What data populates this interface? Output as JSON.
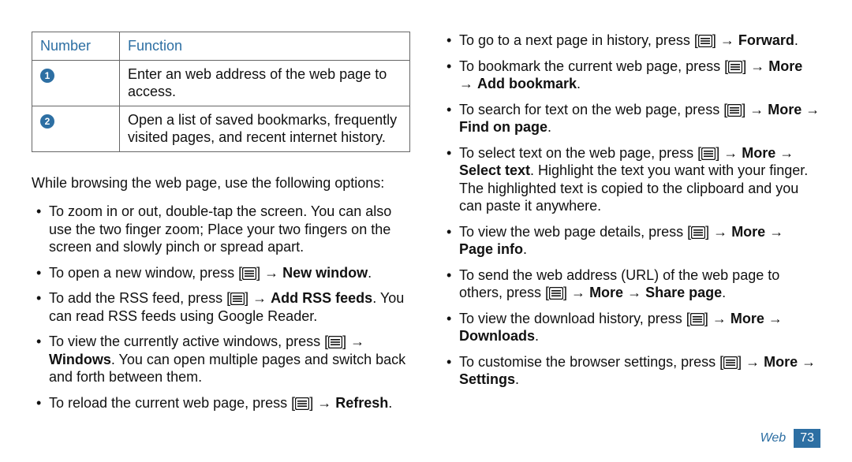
{
  "table": {
    "headers": {
      "number": "Number",
      "function": "Function"
    },
    "rows": [
      {
        "num": "1",
        "func": "Enter an web address of the web page to access."
      },
      {
        "num": "2",
        "func": "Open a list of saved bookmarks, frequently visited pages, and recent internet history."
      }
    ]
  },
  "lead": "While browsing the web page, use the following options:",
  "left_items": [
    {
      "segments": [
        {
          "t": "To zoom in or out, double-tap the screen. You can also use the two finger zoom; Place your two fingers on the screen and slowly pinch or spread apart."
        }
      ]
    },
    {
      "segments": [
        {
          "t": "To open a new window, press ["
        },
        {
          "icon": true
        },
        {
          "t": "] → "
        },
        {
          "t": "New window",
          "b": true
        },
        {
          "t": "."
        }
      ]
    },
    {
      "segments": [
        {
          "t": "To add the RSS feed, press ["
        },
        {
          "icon": true
        },
        {
          "t": "] → "
        },
        {
          "t": "Add RSS feeds",
          "b": true
        },
        {
          "t": ". You can read RSS feeds using Google Reader."
        }
      ]
    },
    {
      "segments": [
        {
          "t": "To view the currently active windows, press ["
        },
        {
          "icon": true
        },
        {
          "t": "] → "
        },
        {
          "t": "Windows",
          "b": true
        },
        {
          "t": ". You can open multiple pages and switch back and forth between them."
        }
      ]
    },
    {
      "segments": [
        {
          "t": "To reload the current web page, press ["
        },
        {
          "icon": true
        },
        {
          "t": "] → "
        },
        {
          "t": "Refresh",
          "b": true
        },
        {
          "t": "."
        }
      ]
    }
  ],
  "right_items": [
    {
      "segments": [
        {
          "t": "To go to a next page in history, press ["
        },
        {
          "icon": true
        },
        {
          "t": "] → "
        },
        {
          "t": "Forward",
          "b": true
        },
        {
          "t": "."
        }
      ]
    },
    {
      "segments": [
        {
          "t": "To bookmark the current web page, press ["
        },
        {
          "icon": true
        },
        {
          "t": "] → "
        },
        {
          "t": "More",
          "b": true
        },
        {
          "t": " → "
        },
        {
          "t": "Add bookmark",
          "b": true
        },
        {
          "t": "."
        }
      ]
    },
    {
      "segments": [
        {
          "t": "To search for text on the web page, press ["
        },
        {
          "icon": true
        },
        {
          "t": "] → "
        },
        {
          "t": "More",
          "b": true
        },
        {
          "t": " → "
        },
        {
          "t": "Find on page",
          "b": true
        },
        {
          "t": "."
        }
      ]
    },
    {
      "segments": [
        {
          "t": "To select text on the web page, press ["
        },
        {
          "icon": true
        },
        {
          "t": "] → "
        },
        {
          "t": "More",
          "b": true
        },
        {
          "t": " → "
        },
        {
          "t": "Select text",
          "b": true
        },
        {
          "t": ". Highlight the text you want with your finger. The highlighted text is copied to the clipboard and you can paste it anywhere."
        }
      ]
    },
    {
      "segments": [
        {
          "t": "To view the web page details, press ["
        },
        {
          "icon": true
        },
        {
          "t": "] → "
        },
        {
          "t": "More",
          "b": true
        },
        {
          "t": " → "
        },
        {
          "t": "Page info",
          "b": true
        },
        {
          "t": "."
        }
      ]
    },
    {
      "segments": [
        {
          "t": "To send the web address (URL) of the web page to others, press ["
        },
        {
          "icon": true
        },
        {
          "t": "] → "
        },
        {
          "t": "More",
          "b": true
        },
        {
          "t": " → "
        },
        {
          "t": "Share page",
          "b": true
        },
        {
          "t": "."
        }
      ]
    },
    {
      "segments": [
        {
          "t": "To view the download history, press ["
        },
        {
          "icon": true
        },
        {
          "t": "] → "
        },
        {
          "t": "More",
          "b": true
        },
        {
          "t": " → "
        },
        {
          "t": "Downloads",
          "b": true
        },
        {
          "t": "."
        }
      ]
    },
    {
      "segments": [
        {
          "t": "To customise the browser settings, press ["
        },
        {
          "icon": true
        },
        {
          "t": "] → "
        },
        {
          "t": "More",
          "b": true
        },
        {
          "t": " → "
        },
        {
          "t": "Settings",
          "b": true
        },
        {
          "t": "."
        }
      ]
    }
  ],
  "footer": {
    "section": "Web",
    "page": "73"
  }
}
